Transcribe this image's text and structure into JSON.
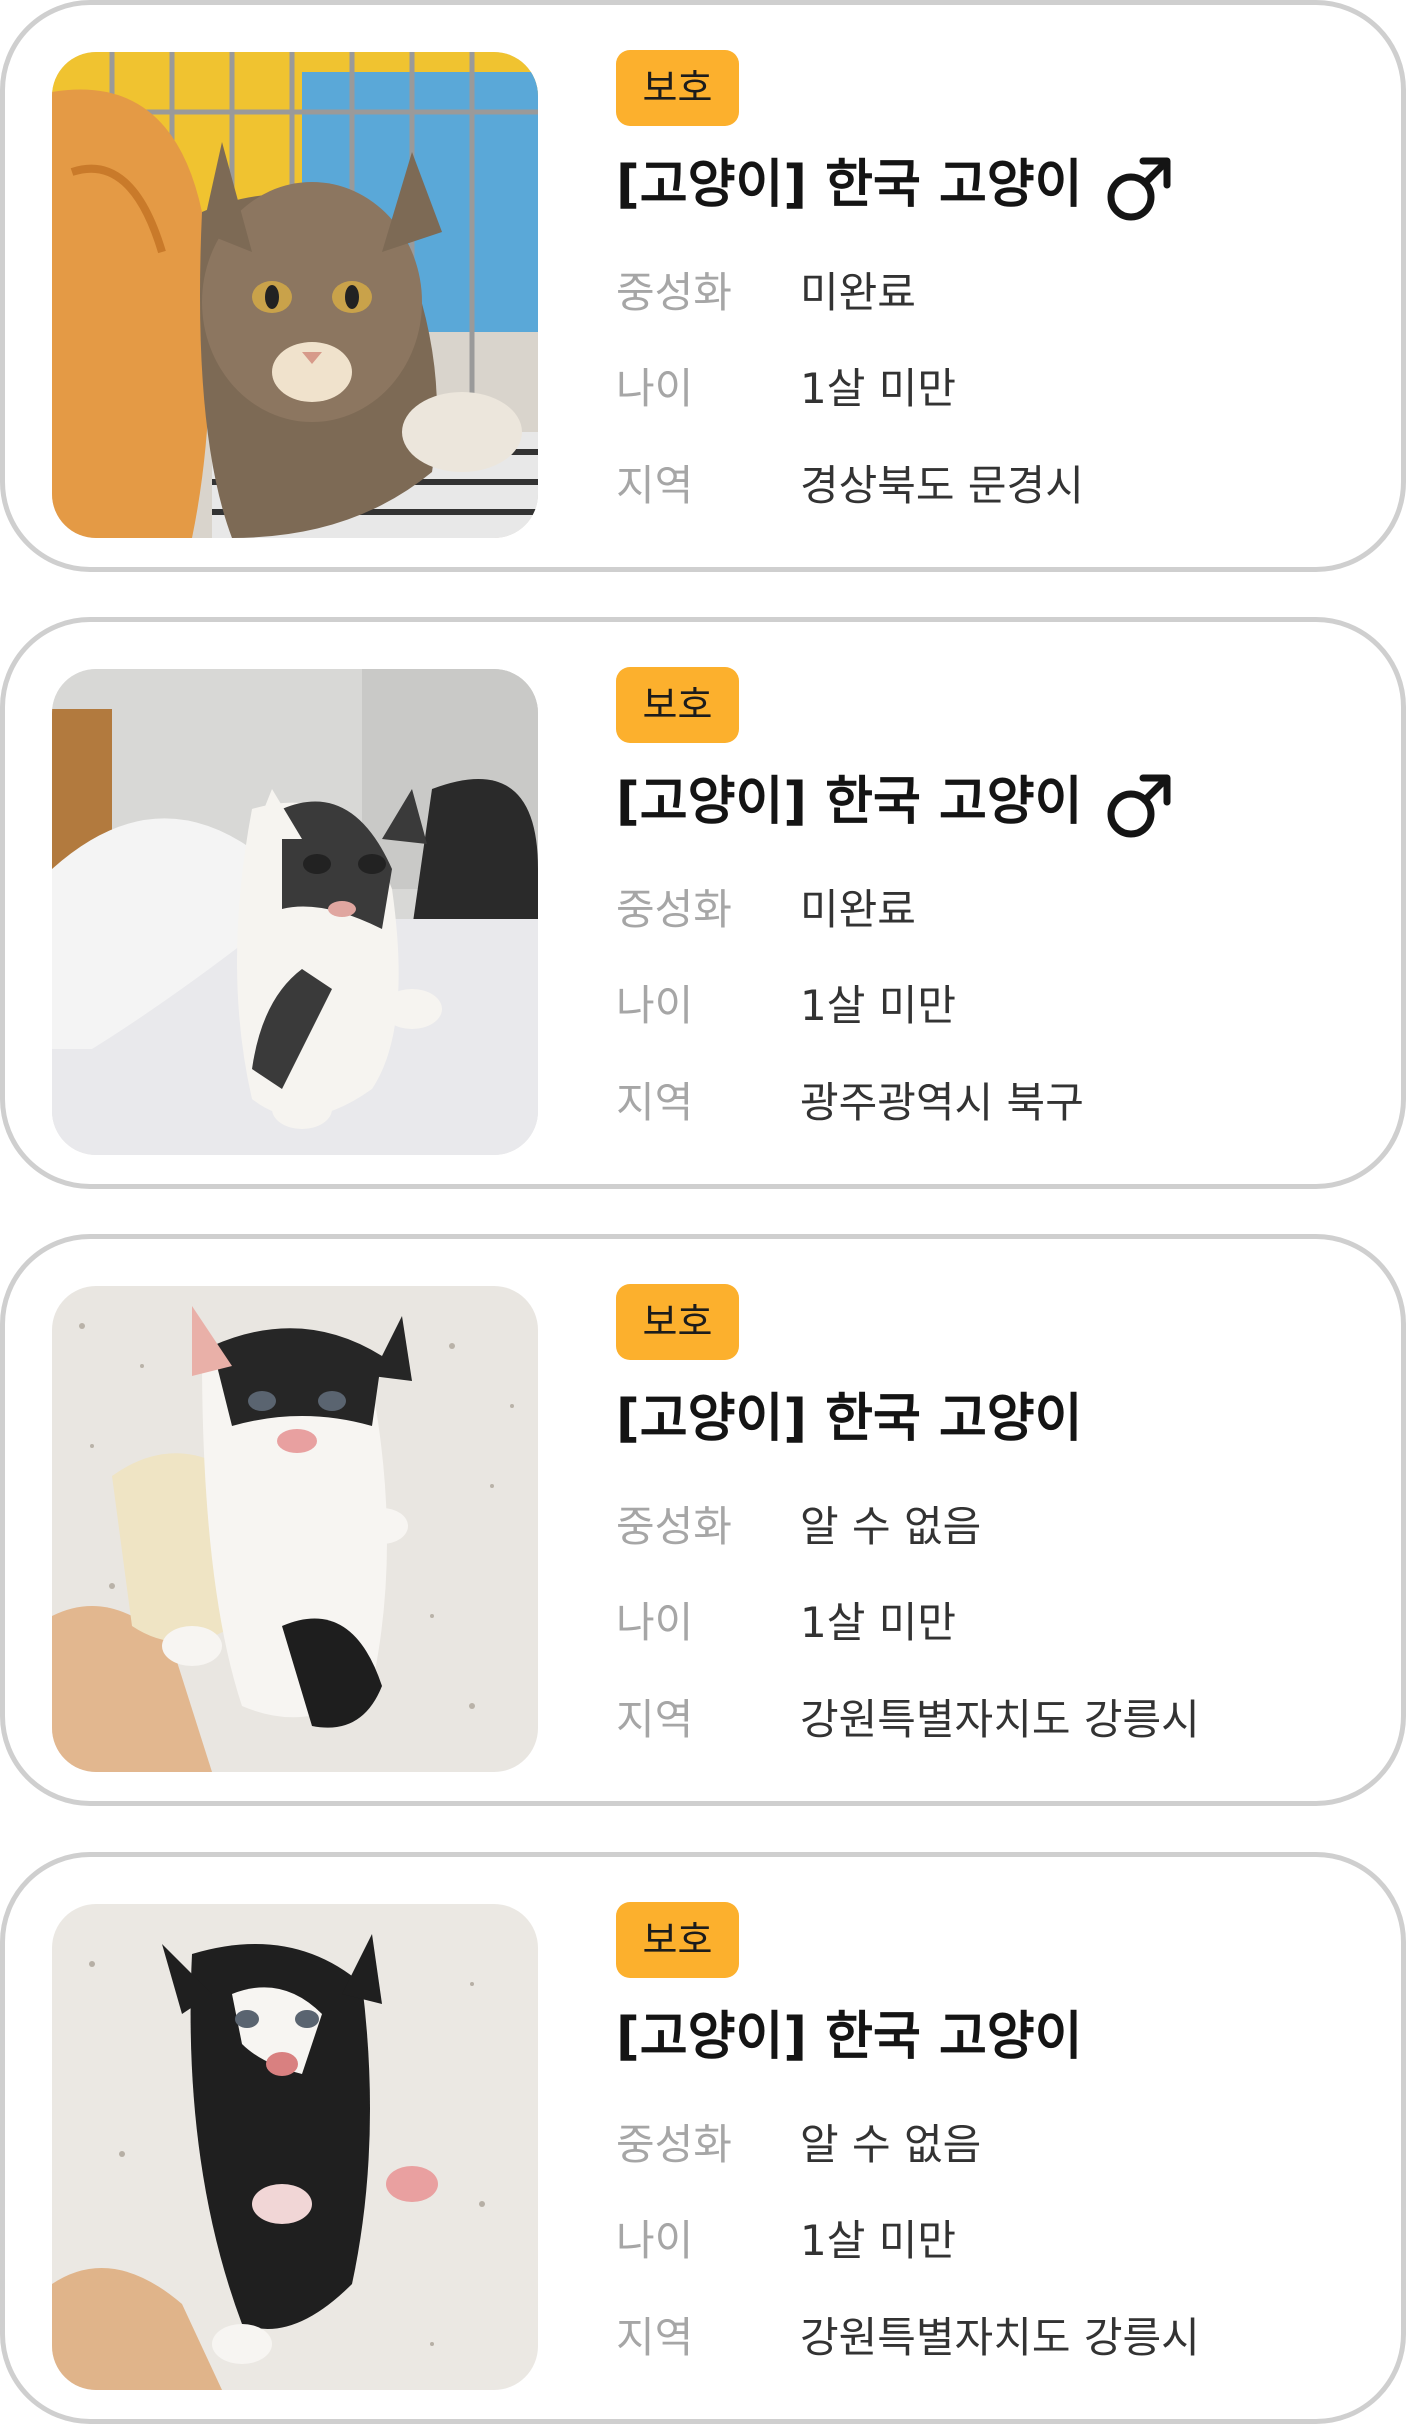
{
  "cards": [
    {
      "badge": "보호",
      "title": "[고양이] 한국 고양이",
      "gender_icon": "male-icon",
      "rows": [
        {
          "label": "중성화",
          "value": "미완료"
        },
        {
          "label": "나이",
          "value": "1살 미만"
        },
        {
          "label": "지역",
          "value": "경상북도 문경시"
        }
      ]
    },
    {
      "badge": "보호",
      "title": "[고양이] 한국 고양이",
      "gender_icon": "male-icon",
      "rows": [
        {
          "label": "중성화",
          "value": "미완료"
        },
        {
          "label": "나이",
          "value": "1살 미만"
        },
        {
          "label": "지역",
          "value": "광주광역시 북구"
        }
      ]
    },
    {
      "badge": "보호",
      "title": "[고양이] 한국 고양이",
      "rows": [
        {
          "label": "중성화",
          "value": "알 수 없음"
        },
        {
          "label": "나이",
          "value": "1살 미만"
        },
        {
          "label": "지역",
          "value": "강원특별자치도 강릉시"
        }
      ]
    },
    {
      "badge": "보호",
      "title": "[고양이] 한국 고양이",
      "rows": [
        {
          "label": "중성화",
          "value": "알 수 없음"
        },
        {
          "label": "나이",
          "value": "1살 미만"
        },
        {
          "label": "지역",
          "value": "강원특별자치도 강릉시"
        }
      ]
    }
  ],
  "colors": {
    "badge_bg": "#fcb02d",
    "card_border": "#cfcfcf",
    "label_text": "#a6a6a6",
    "value_text": "#333333",
    "title_text": "#141414"
  }
}
